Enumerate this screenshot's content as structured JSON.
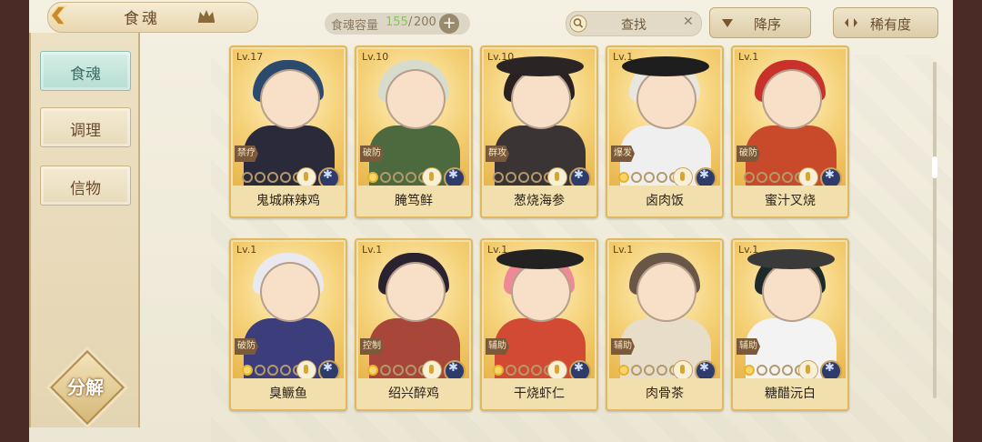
{
  "header": {
    "title": "食魂",
    "capacity_label": "食魂容量",
    "capacity_current": "155",
    "capacity_separator": "/",
    "capacity_max": "200",
    "capacity_add": "+",
    "search_placeholder": "查找",
    "search_clear": "✕",
    "sort_desc_label": "降序",
    "sort_rarity_label": "稀有度"
  },
  "sidebar": {
    "items": [
      {
        "label": "食魂",
        "active": true
      },
      {
        "label": "调理",
        "active": false
      },
      {
        "label": "信物",
        "active": false
      }
    ],
    "decompose_label": "分解"
  },
  "cards": [
    {
      "level": "Lv.17",
      "name": "鬼城麻辣鸡",
      "role": "禁疗",
      "stars": 0,
      "hair": "#2b4a6e",
      "body": "#2a2a3a",
      "hat": ""
    },
    {
      "level": "Lv.10",
      "name": "腌笃鲜",
      "role": "破防",
      "stars": 1,
      "hair": "#d8dccd",
      "body": "#4c6a3e",
      "hat": ""
    },
    {
      "level": "Lv.10",
      "name": "葱烧海参",
      "role": "群攻",
      "stars": 0,
      "hair": "#2a2020",
      "body": "#3a3434",
      "hat": "#2a2424"
    },
    {
      "level": "Lv.1",
      "name": "卤肉饭",
      "role": "爆发",
      "stars": 1,
      "hair": "#e9e6df",
      "body": "#efefef",
      "hat": "#1e1e1e"
    },
    {
      "level": "Lv.1",
      "name": "蜜汁叉烧",
      "role": "破防",
      "stars": 0,
      "hair": "#c8322a",
      "body": "#c94a2a",
      "hat": ""
    },
    {
      "level": "Lv.1",
      "name": "臭鳜鱼",
      "role": "破防",
      "stars": 1,
      "hair": "#e9e9ef",
      "body": "#3b3e7a",
      "hat": ""
    },
    {
      "level": "Lv.1",
      "name": "绍兴醉鸡",
      "role": "控制",
      "stars": 1,
      "hair": "#2a2230",
      "body": "#a8463a",
      "hat": ""
    },
    {
      "level": "Lv.1",
      "name": "干烧虾仁",
      "role": "辅助",
      "stars": 1,
      "hair": "#ee8a96",
      "body": "#d24a33",
      "hat": "#222"
    },
    {
      "level": "Lv.1",
      "name": "肉骨茶",
      "role": "辅助",
      "stars": 1,
      "hair": "#6a5646",
      "body": "#e8ddc8",
      "hat": ""
    },
    {
      "level": "Lv.1",
      "name": "糖醋沅白",
      "role": "辅助",
      "stars": 1,
      "hair": "#1e2a2a",
      "body": "#f3f3f3",
      "hat": "#3a3a3a"
    }
  ]
}
